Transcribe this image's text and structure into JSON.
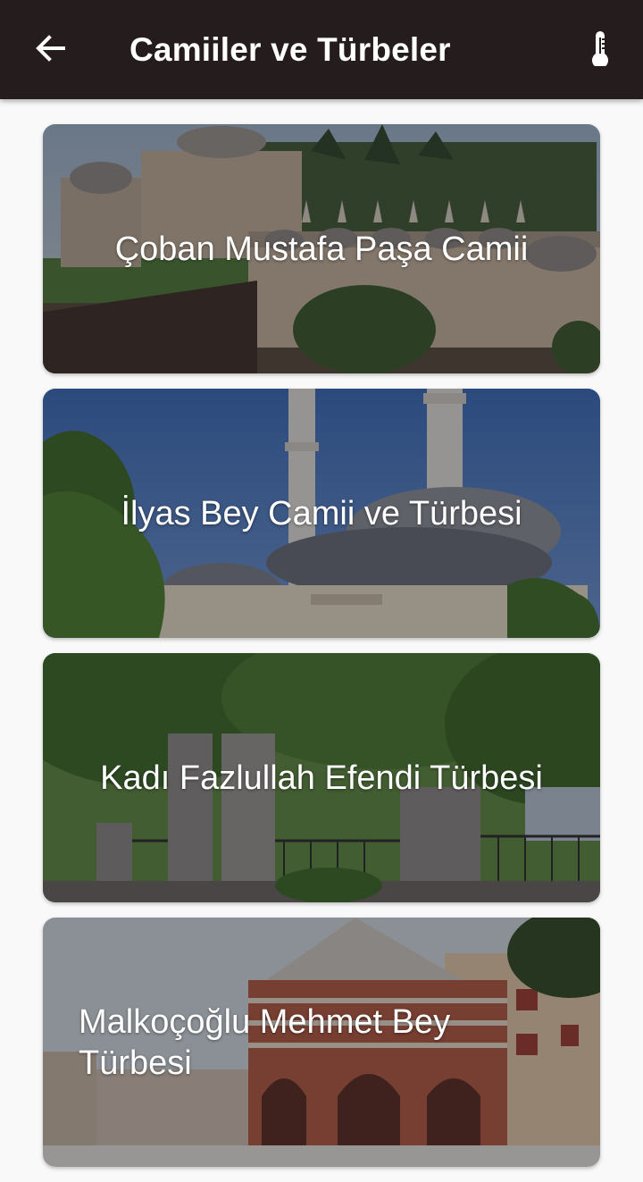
{
  "appbar": {
    "title": "Camiiler ve Türbeler",
    "back_icon": "arrow-left-icon",
    "action_icon": "thermometer-icon",
    "background": "#251d1d"
  },
  "cards": [
    {
      "label": "Çoban Mustafa Paşa Camii"
    },
    {
      "label": "İlyas Bey Camii ve Türbesi"
    },
    {
      "label": "Kadı Fazlullah Efendi Türbesi"
    },
    {
      "label": "Malkoçoğlu Mehmet Bey Türbesi"
    }
  ]
}
